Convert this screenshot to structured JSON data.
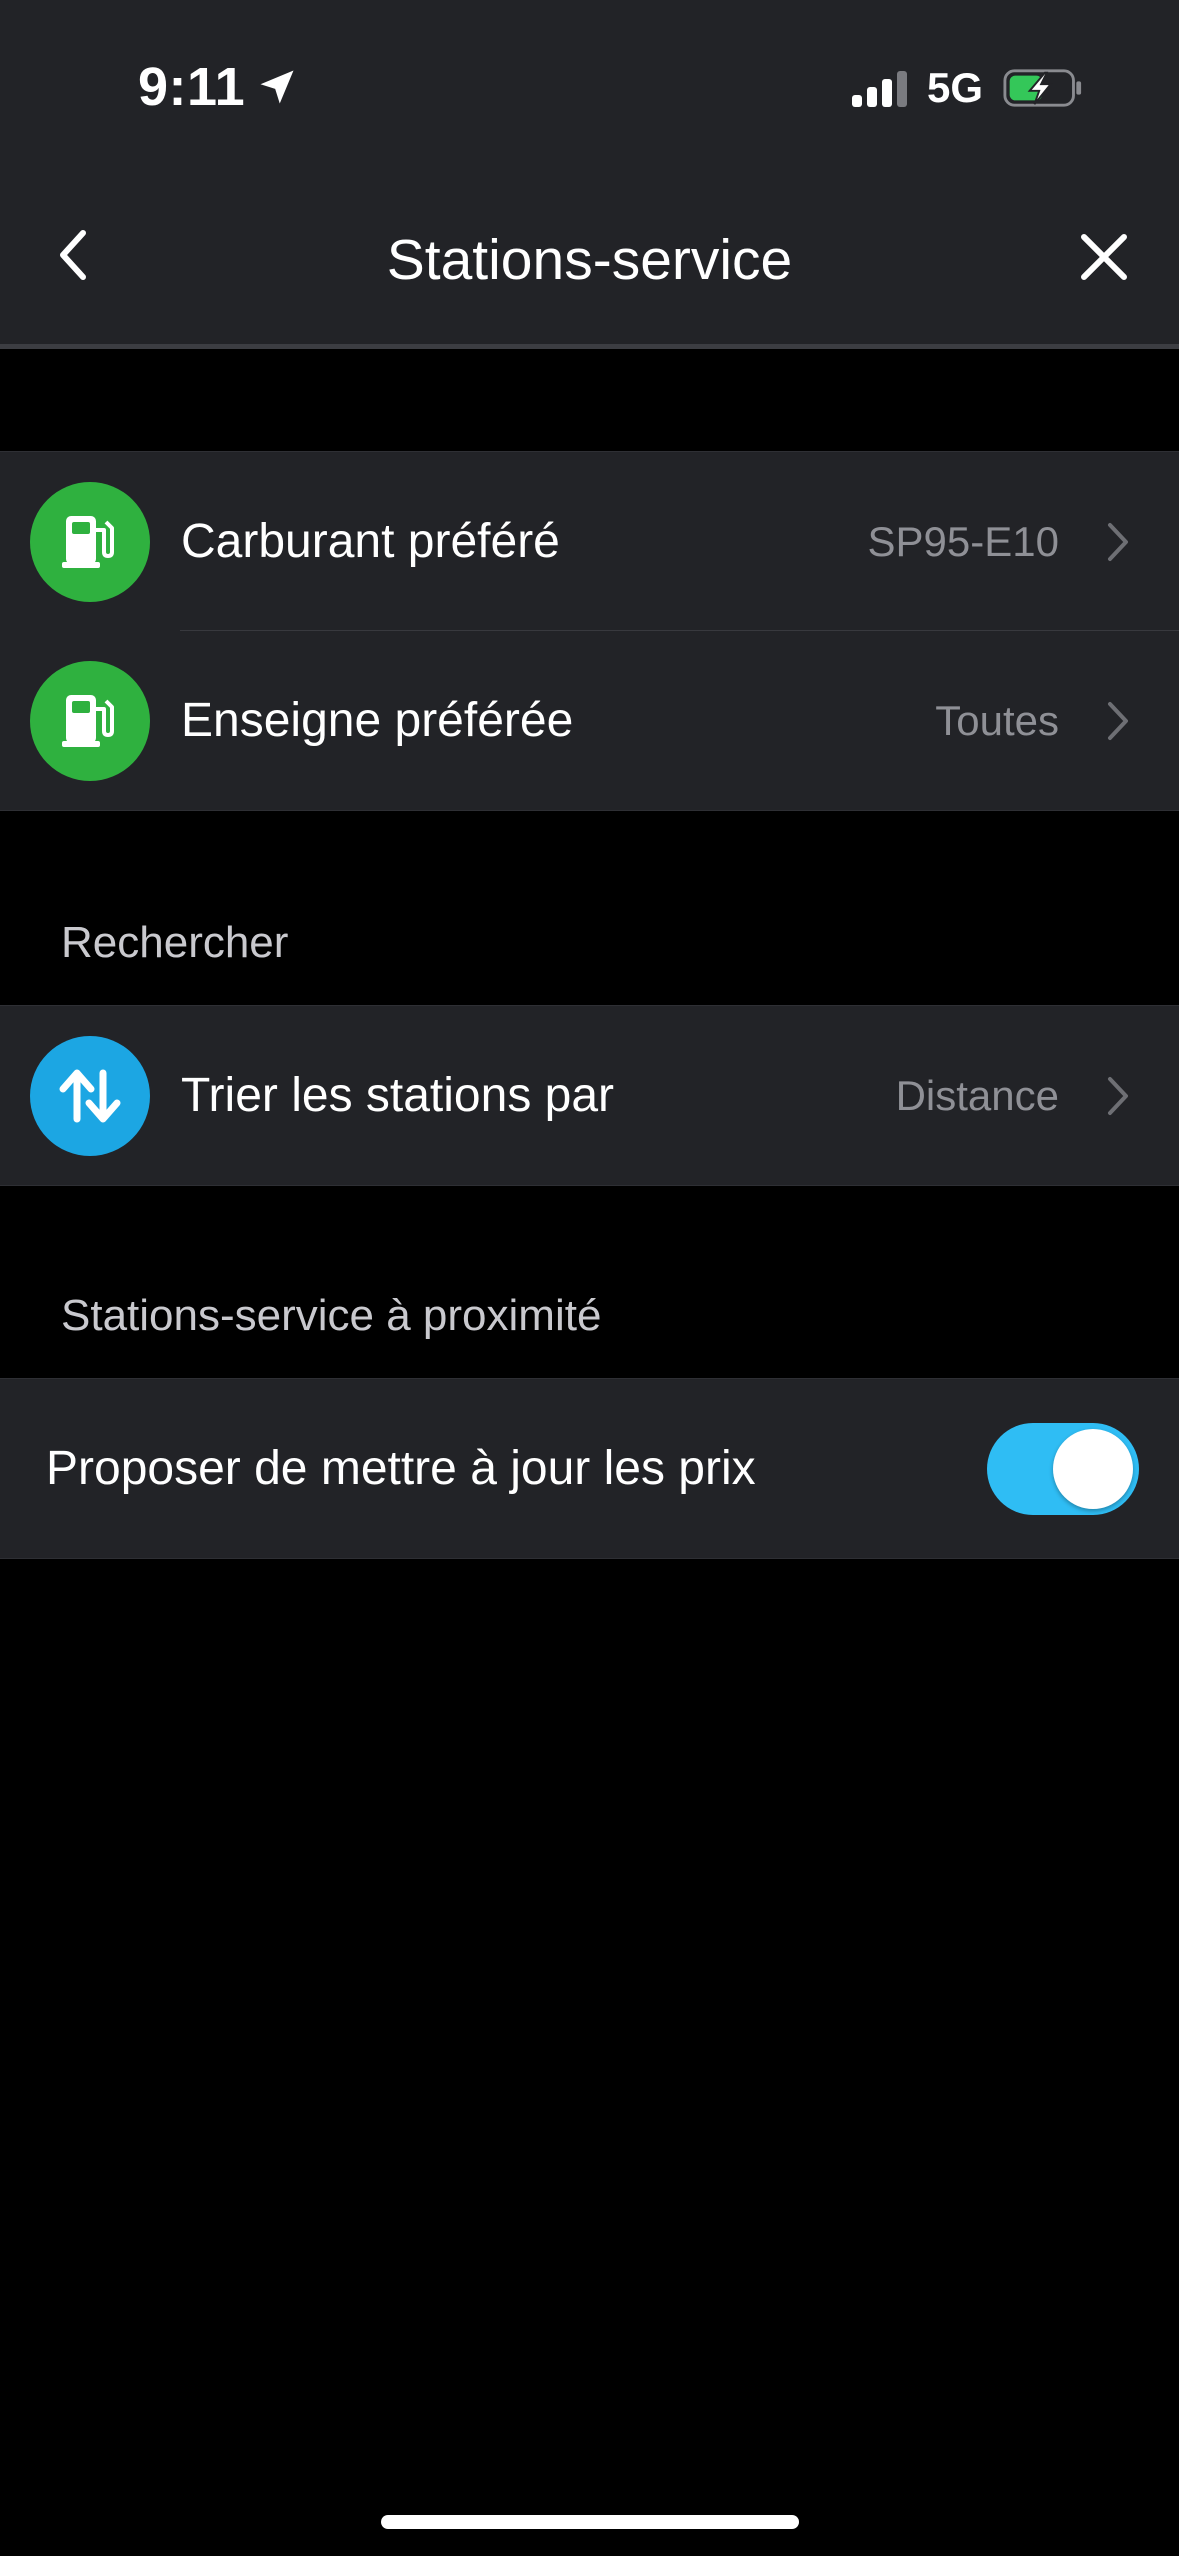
{
  "status_bar": {
    "time": "9:11",
    "network": "5G",
    "location_icon": "location-arrow-icon",
    "battery_state": "charging"
  },
  "nav": {
    "title": "Stations-service",
    "back_icon": "chevron-left-icon",
    "close_icon": "close-icon"
  },
  "preferences": {
    "items": [
      {
        "label": "Carburant préféré",
        "value": "SP95-E10",
        "icon": "fuel-pump-icon"
      },
      {
        "label": "Enseigne préférée",
        "value": "Toutes",
        "icon": "fuel-pump-icon"
      }
    ]
  },
  "search": {
    "header": "Rechercher",
    "items": [
      {
        "label": "Trier les stations par",
        "value": "Distance",
        "icon": "sort-arrows-icon"
      }
    ]
  },
  "nearby": {
    "header": "Stations-service à proximité",
    "items": [
      {
        "label": "Proposer de mettre à jour les prix",
        "toggle_on": true
      }
    ]
  },
  "colors": {
    "background": "#000000",
    "surface": "#222327",
    "green_icon": "#2fb13f",
    "blue_icon": "#1ca6e3",
    "toggle_on": "#2fbdf4",
    "secondary_text": "#8f9096"
  }
}
